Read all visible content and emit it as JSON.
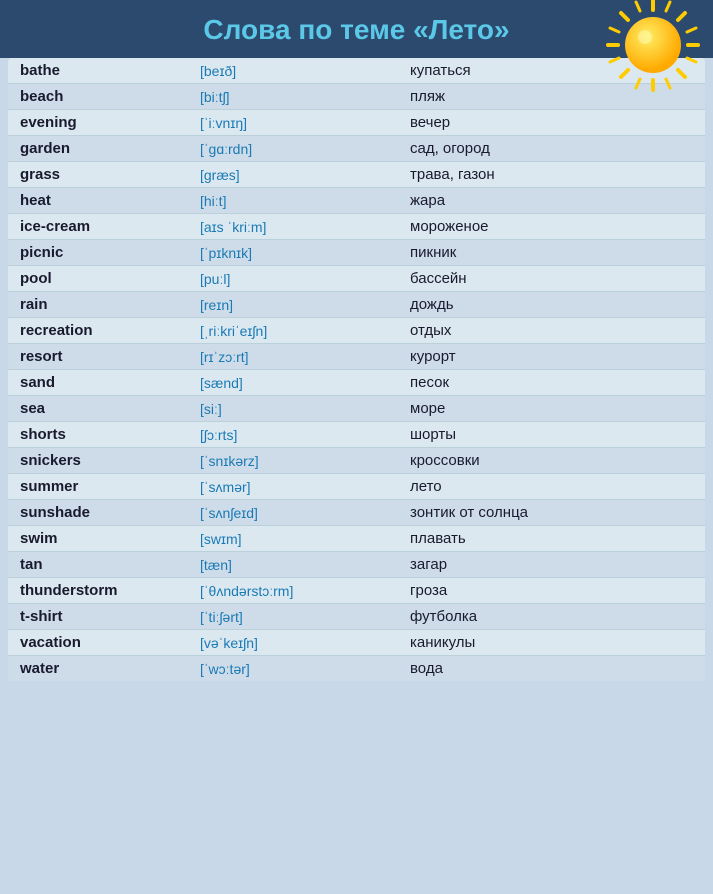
{
  "header": {
    "title": "Слова по теме «Лето»"
  },
  "words": [
    {
      "english": "bathe",
      "transcription": "[beɪð]",
      "russian": "купаться"
    },
    {
      "english": "beach",
      "transcription": "[biːtʃ]",
      "russian": "пляж"
    },
    {
      "english": "evening",
      "transcription": "[ˈiːvnɪŋ]",
      "russian": "вечер"
    },
    {
      "english": "garden",
      "transcription": "[ˈɡɑːrdn]",
      "russian": "сад, огород"
    },
    {
      "english": "grass",
      "transcription": "[ɡræs]",
      "russian": "трава, газон"
    },
    {
      "english": "heat",
      "transcription": "[hiːt]",
      "russian": "жара"
    },
    {
      "english": "ice-cream",
      "transcription": "[aɪs ˈkriːm]",
      "russian": "мороженое"
    },
    {
      "english": "picnic",
      "transcription": "[ˈpɪknɪk]",
      "russian": "пикник"
    },
    {
      "english": "pool",
      "transcription": "[puːl]",
      "russian": "бассейн"
    },
    {
      "english": "rain",
      "transcription": "[reɪn]",
      "russian": "дождь"
    },
    {
      "english": "recreation",
      "transcription": "[ˌriːkriˈeɪʃn]",
      "russian": "отдых"
    },
    {
      "english": "resort",
      "transcription": "[rɪˈzɔːrt]",
      "russian": "курорт"
    },
    {
      "english": "sand",
      "transcription": "[sænd]",
      "russian": "песок"
    },
    {
      "english": "sea",
      "transcription": "[siː]",
      "russian": "море"
    },
    {
      "english": "shorts",
      "transcription": "[ʃɔːrts]",
      "russian": "шорты"
    },
    {
      "english": "snickers",
      "transcription": "[ˈsnɪkərz]",
      "russian": "кроссовки"
    },
    {
      "english": "summer",
      "transcription": "[ˈsʌmər]",
      "russian": "лето"
    },
    {
      "english": "sunshade",
      "transcription": "[ˈsʌnʃeɪd]",
      "russian": "зонтик от солнца"
    },
    {
      "english": "swim",
      "transcription": "[swɪm]",
      "russian": "плавать"
    },
    {
      "english": "tan",
      "transcription": "[tæn]",
      "russian": "загар"
    },
    {
      "english": "thunderstorm",
      "transcription": "[ˈθʌndərstɔːrm]",
      "russian": "гроза"
    },
    {
      "english": "t-shirt",
      "transcription": "[ˈtiːʃərt]",
      "russian": "футболка"
    },
    {
      "english": "vacation",
      "transcription": "[vəˈkeɪʃn]",
      "russian": "каникулы"
    },
    {
      "english": "water",
      "transcription": "[ˈwɔːtər]",
      "russian": "вода"
    }
  ]
}
